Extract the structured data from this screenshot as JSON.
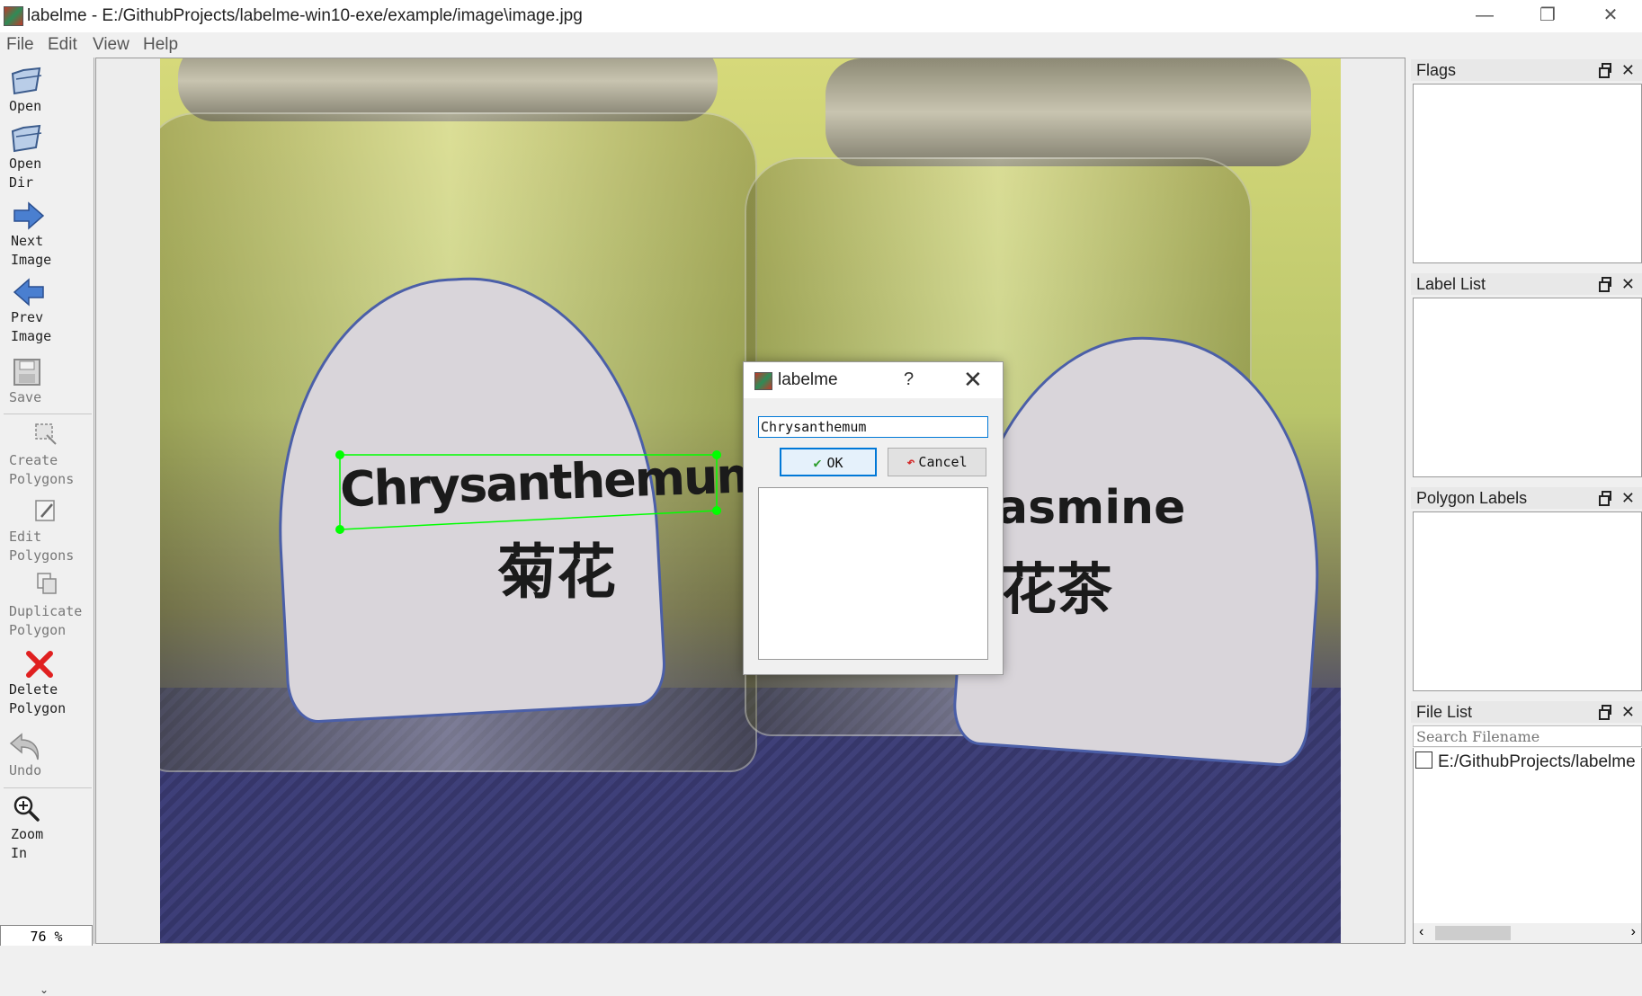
{
  "window": {
    "title": "labelme - E:/GithubProjects/labelme-win10-exe/example/image\\image.jpg",
    "controls": {
      "minimize": "—",
      "restore": "❐",
      "close": "✕"
    }
  },
  "menu": {
    "items": [
      "File",
      "Edit",
      "View",
      "Help"
    ]
  },
  "toolbar": {
    "tools": [
      {
        "label": "Open",
        "icon": "folder-open-icon",
        "enabled": true
      },
      {
        "label": "Open\nDir",
        "icon": "folder-open-icon",
        "enabled": true
      },
      {
        "label": "Next\nImage",
        "icon": "arrow-right-icon",
        "enabled": true
      },
      {
        "label": "Prev\nImage",
        "icon": "arrow-left-icon",
        "enabled": true
      },
      {
        "label": "Save",
        "icon": "save-icon",
        "enabled": false
      },
      {
        "label": "Create\nPolygons",
        "icon": "create-polygon-icon",
        "enabled": false
      },
      {
        "label": "Edit\nPolygons",
        "icon": "edit-polygon-icon",
        "enabled": false
      },
      {
        "label": "Duplicate\nPolygon",
        "icon": "duplicate-icon",
        "enabled": false
      },
      {
        "label": "Delete\nPolygon",
        "icon": "delete-x-icon",
        "enabled": true
      },
      {
        "label": "Undo",
        "icon": "undo-icon",
        "enabled": false
      },
      {
        "label": "Zoom\nIn",
        "icon": "zoom-in-icon",
        "enabled": true
      }
    ],
    "zoom_value": "76 %",
    "more_indicator": "⌄"
  },
  "image": {
    "left_label": {
      "english": "Chrysanthemum",
      "chinese": "菊花"
    },
    "right_label": {
      "english": "asmine",
      "chinese": "花茶"
    },
    "annotation_color": "#00ff00"
  },
  "docks": {
    "flags": {
      "title": "Flags"
    },
    "label_list": {
      "title": "Label List"
    },
    "polygon_labels": {
      "title": "Polygon Labels"
    },
    "file_list": {
      "title": "File List",
      "search_placeholder": "Search Filename",
      "files": [
        "E:/GithubProjects/labelme"
      ]
    }
  },
  "dialog": {
    "title": "labelme",
    "help": "?",
    "close": "✕",
    "input_value": "Chrysanthemum",
    "ok_label": "OK",
    "cancel_label": "Cancel"
  }
}
